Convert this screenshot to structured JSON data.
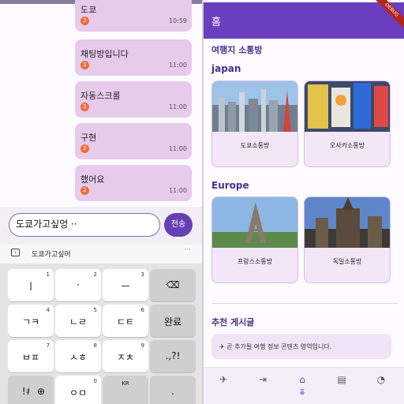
{
  "chat": {
    "messages": [
      {
        "text": "도쿄",
        "badge": "2",
        "time": "10:59"
      },
      {
        "text": "채팅방입니다",
        "badge": "2",
        "time": "11:00"
      },
      {
        "text": "자동스크롤",
        "badge": "2",
        "time": "11:00"
      },
      {
        "text": "구현",
        "badge": "2",
        "time": "11:00"
      },
      {
        "text": "했어요",
        "badge": "2",
        "time": "11:00"
      }
    ],
    "input_value": "도쿄가고싶엉 ·· ",
    "send_label": "전송"
  },
  "keyboard": {
    "suggestion": "도쿄가고싶어",
    "more": "···",
    "keys": [
      {
        "label": "ㅣ",
        "num": "1"
      },
      {
        "label": "·",
        "num": "2"
      },
      {
        "label": "ㅡ",
        "num": "3"
      },
      {
        "label": "⌫",
        "num": ""
      },
      {
        "label": "ㄱㅋ",
        "num": "4"
      },
      {
        "label": "ㄴㄹ",
        "num": "5"
      },
      {
        "label": "ㄷㅌ",
        "num": "6"
      },
      {
        "label": "완료",
        "num": ""
      },
      {
        "label": "ㅂㅍ",
        "num": "7"
      },
      {
        "label": "ㅅㅎ",
        "num": "8"
      },
      {
        "label": "ㅈㅊ",
        "num": "9"
      },
      {
        "label": ".,?!",
        "num": ""
      },
      {
        "label": "!#1",
        "num": ""
      },
      {
        "label": "⊕",
        "num": ""
      },
      {
        "label": "ㅇㅁ",
        "num": "0"
      },
      {
        "label": "KR",
        "num": ""
      }
    ]
  },
  "app": {
    "title": "홈",
    "debug_label": "DEBUG",
    "section1": "여행지 소통방",
    "region_japan": "japan",
    "region_europe": "Europe",
    "cards": [
      {
        "name": "도쿄소통방"
      },
      {
        "name": "오사카소통방"
      },
      {
        "name": "프랑스소통방"
      },
      {
        "name": "독일소통방"
      }
    ],
    "section2": "추천 게시글",
    "banner": "곧 추가될 여행 정보 콘텐츠 영역입니다.",
    "nav": [
      {
        "icon": "airplane-icon",
        "glyph": "✈",
        "label": ""
      },
      {
        "icon": "login-icon",
        "glyph": "⇥",
        "label": ""
      },
      {
        "icon": "home-icon",
        "glyph": "⌂",
        "label": "홈"
      },
      {
        "icon": "calendar-icon",
        "glyph": "▤",
        "label": ""
      },
      {
        "icon": "speedometer-icon",
        "glyph": "◔",
        "label": ""
      }
    ]
  },
  "colors": {
    "primary": "#6a3fbf",
    "bubble": "#e6cbea",
    "badge": "#f06c3a"
  }
}
